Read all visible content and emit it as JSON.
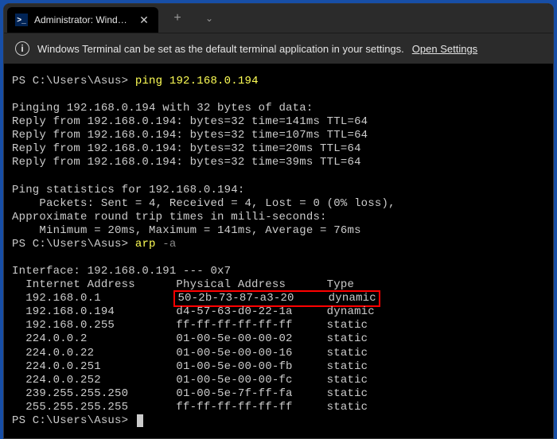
{
  "tab": {
    "title": "Administrator: Windows PowerS"
  },
  "infobar": {
    "message": "Windows Terminal can be set as the default terminal application in your settings.",
    "link": "Open Settings"
  },
  "prompt": "PS C:\\Users\\Asus>",
  "cmd_ping": "ping",
  "ping_target": "192.168.0.194",
  "ping_header": "Pinging 192.168.0.194 with 32 bytes of data:",
  "ping_replies": [
    "Reply from 192.168.0.194: bytes=32 time=141ms TTL=64",
    "Reply from 192.168.0.194: bytes=32 time=107ms TTL=64",
    "Reply from 192.168.0.194: bytes=32 time=20ms TTL=64",
    "Reply from 192.168.0.194: bytes=32 time=39ms TTL=64"
  ],
  "ping_stats_header": "Ping statistics for 192.168.0.194:",
  "ping_packets": "    Packets: Sent = 4, Received = 4, Lost = 0 (0% loss),",
  "ping_rtt_header": "Approximate round trip times in milli-seconds:",
  "ping_rtt": "    Minimum = 20ms, Maximum = 141ms, Average = 76ms",
  "cmd_arp": "arp",
  "arp_flag": "-a",
  "arp_interface": "Interface: 192.168.0.191 --- 0x7",
  "arp_header": {
    "ip": "Internet Address",
    "mac": "Physical Address",
    "type": "Type"
  },
  "arp_rows": [
    {
      "ip": "192.168.0.1",
      "mac": "50-2b-73-87-a3-20",
      "type": "dynamic",
      "highlight": true
    },
    {
      "ip": "192.168.0.194",
      "mac": "d4-57-63-d0-22-1a",
      "type": "dynamic"
    },
    {
      "ip": "192.168.0.255",
      "mac": "ff-ff-ff-ff-ff-ff",
      "type": "static"
    },
    {
      "ip": "224.0.0.2",
      "mac": "01-00-5e-00-00-02",
      "type": "static"
    },
    {
      "ip": "224.0.0.22",
      "mac": "01-00-5e-00-00-16",
      "type": "static"
    },
    {
      "ip": "224.0.0.251",
      "mac": "01-00-5e-00-00-fb",
      "type": "static"
    },
    {
      "ip": "224.0.0.252",
      "mac": "01-00-5e-00-00-fc",
      "type": "static"
    },
    {
      "ip": "239.255.255.250",
      "mac": "01-00-5e-7f-ff-fa",
      "type": "static"
    },
    {
      "ip": "255.255.255.255",
      "mac": "ff-ff-ff-ff-ff-ff",
      "type": "static"
    }
  ]
}
